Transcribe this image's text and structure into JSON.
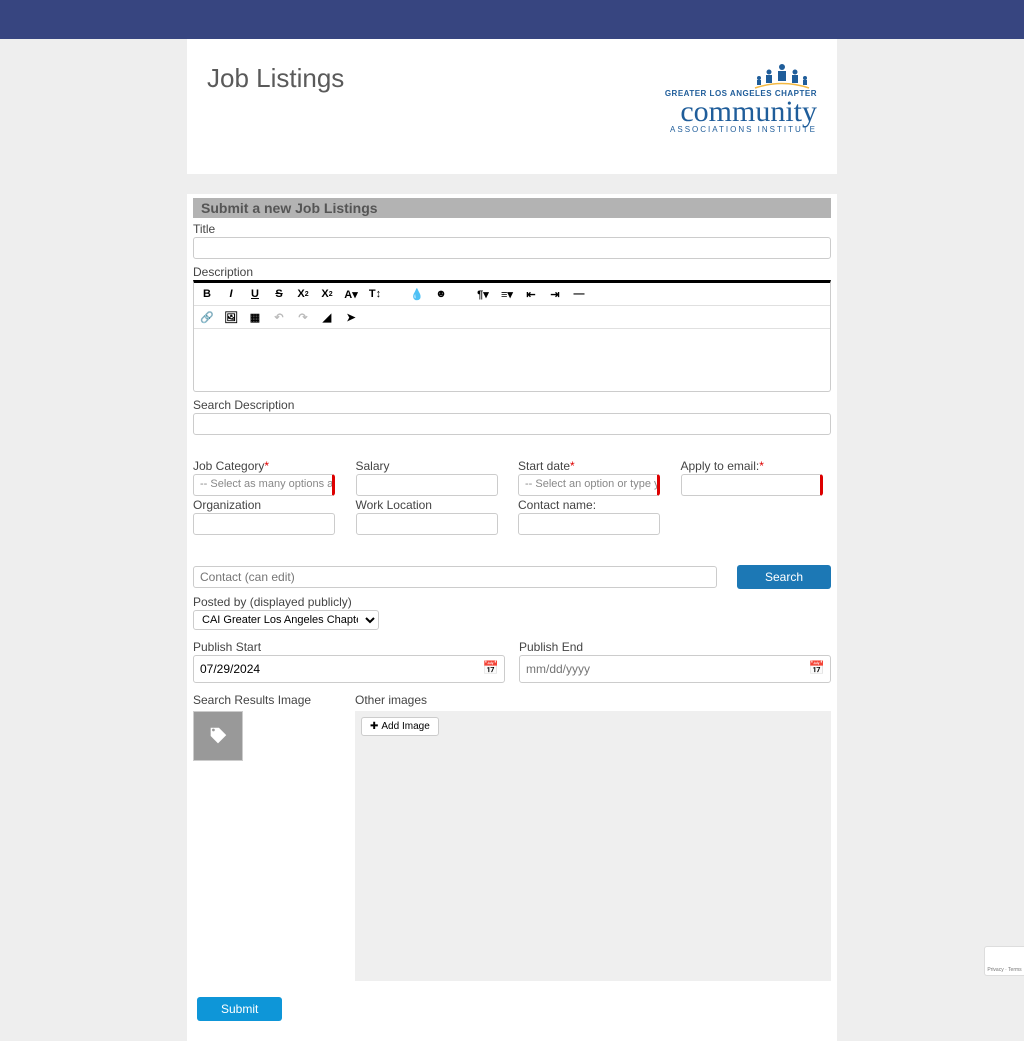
{
  "header": {
    "page_title": "Job Listings",
    "logo": {
      "tag": "GREATER LOS ANGELES CHAPTER",
      "main": "community",
      "sub": "ASSOCIATIONS INSTITUTE"
    }
  },
  "section_title": "Submit a new Job Listings",
  "labels": {
    "title": "Title",
    "description": "Description",
    "search_description": "Search Description",
    "job_category": "Job Category",
    "salary": "Salary",
    "start_date": "Start date",
    "apply_email": "Apply to email:",
    "organization": "Organization",
    "work_location": "Work Location",
    "contact_name": "Contact name:",
    "posted_by": "Posted by (displayed publicly)",
    "publish_start": "Publish Start",
    "publish_end": "Publish End",
    "search_results_image": "Search Results Image",
    "other_images": "Other images"
  },
  "placeholders": {
    "job_category": "-- Select as many options as apply",
    "start_date": "-- Select an option or type your",
    "contact_search": "Contact (can edit)",
    "publish_end": "mm/dd/yyyy"
  },
  "values": {
    "posted_by": "CAI Greater Los Angeles Chapter",
    "publish_start": "07/29/2024"
  },
  "buttons": {
    "search": "Search",
    "submit": "Submit",
    "add_image": "Add Image"
  },
  "recaptcha": "Privacy · Terms"
}
